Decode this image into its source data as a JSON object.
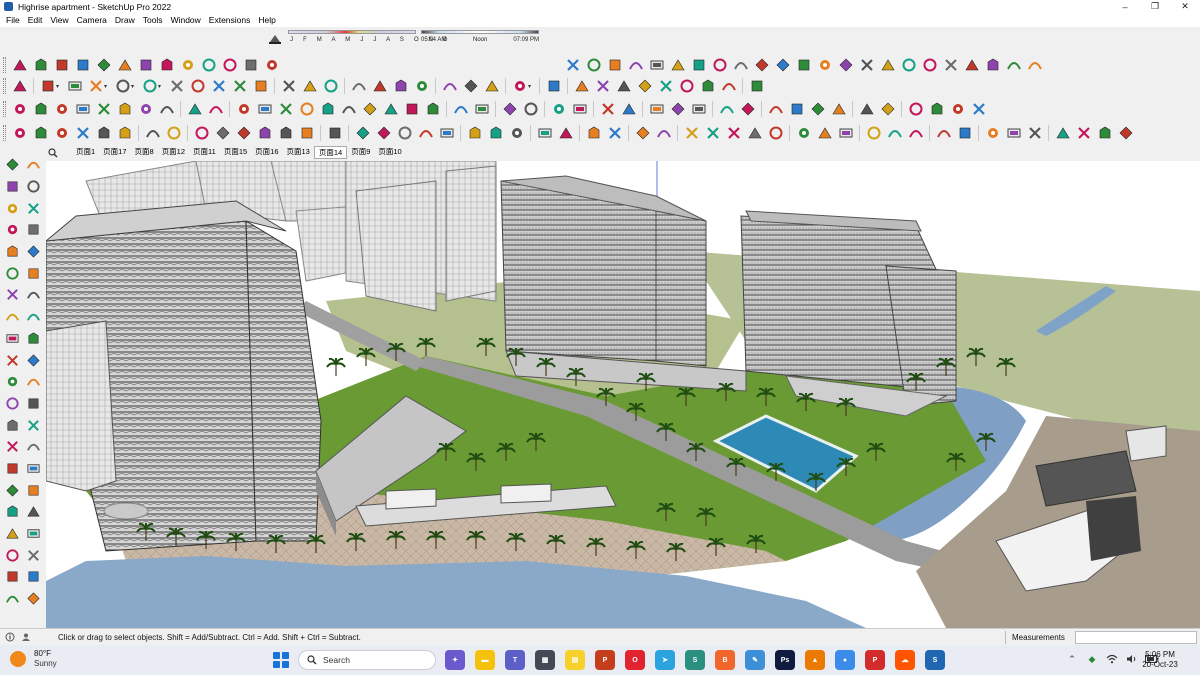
{
  "window": {
    "title": "Highrise apartment - SketchUp Pro 2022",
    "controls": [
      "–",
      "❐",
      "✕"
    ]
  },
  "menu": [
    "File",
    "Edit",
    "View",
    "Camera",
    "Draw",
    "Tools",
    "Window",
    "Extensions",
    "Help"
  ],
  "shadows": {
    "months": "J F M A M J J A S O N D",
    "time_start": "05:04 AM",
    "time_noon": "Noon",
    "time_end": "07:09 PM"
  },
  "scenes": {
    "tabs": [
      "页面1",
      "页面17",
      "页面8",
      "页面12",
      "页面11",
      "页面15",
      "页面16",
      "页面13",
      "页面14",
      "页面9",
      "页面10"
    ],
    "active_index": 8
  },
  "status": {
    "hint": "Click or drag to select objects. Shift = Add/Subtract. Ctrl = Add. Shift + Ctrl = Subtract.",
    "measurements_label": "Measurements",
    "measurements_value": ""
  },
  "taskbar": {
    "weather_temp": "80°F",
    "weather_desc": "Sunny",
    "search_label": "Search",
    "time": "5:06 PM",
    "date": "20-Oct-23",
    "apps": [
      {
        "name": "copilot-icon",
        "color": "#6a5acd",
        "glyph": "✦"
      },
      {
        "name": "file-explorer-icon",
        "color": "#f4c20d",
        "glyph": "▬"
      },
      {
        "name": "teams-icon",
        "color": "#5b5fc7",
        "glyph": "T"
      },
      {
        "name": "calculator-icon",
        "color": "#444a55",
        "glyph": "▦"
      },
      {
        "name": "sticky-notes-icon",
        "color": "#f7d12b",
        "glyph": "▤"
      },
      {
        "name": "powerpoint-icon",
        "color": "#c43e1c",
        "glyph": "P"
      },
      {
        "name": "opera-icon",
        "color": "#e0232e",
        "glyph": "O"
      },
      {
        "name": "telegram-icon",
        "color": "#2aa3df",
        "glyph": "➤"
      },
      {
        "name": "sketchup-app-icon",
        "color": "#2a8f7f",
        "glyph": "S"
      },
      {
        "name": "brave-icon",
        "color": "#f2652b",
        "glyph": "B"
      },
      {
        "name": "paint-icon",
        "color": "#3d8fd8",
        "glyph": "✎"
      },
      {
        "name": "photoshop-icon",
        "color": "#0f1c3f",
        "glyph": "Ps"
      },
      {
        "name": "vlc-icon",
        "color": "#ec7a00",
        "glyph": "▲"
      },
      {
        "name": "chrome-icon",
        "color": "#3b8beb",
        "glyph": "●"
      },
      {
        "name": "pinterest-icon",
        "color": "#d32b2b",
        "glyph": "P"
      },
      {
        "name": "soundcloud-icon",
        "color": "#ff5500",
        "glyph": "☁"
      },
      {
        "name": "sketchup-active-icon",
        "color": "#2066b0",
        "glyph": "S"
      }
    ]
  },
  "colors": {
    "accent": "#1a73d9",
    "water": "#8aa9c9",
    "grass": "#5d8a2a",
    "pool": "#2d8ab7"
  }
}
